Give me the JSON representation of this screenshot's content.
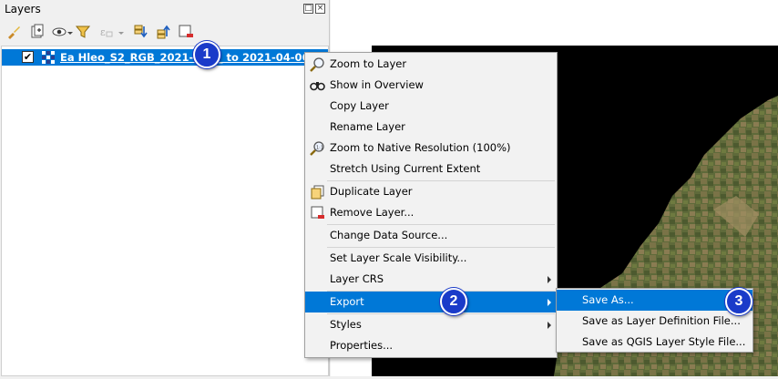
{
  "panel": {
    "title": "Layers",
    "float_btn": "□",
    "close_btn": "×"
  },
  "toolbar": {
    "icons": [
      "paintbrush-icon",
      "add-group-icon",
      "eye-icon",
      "filter-icon",
      "filter-expression-icon",
      "expand-all-icon",
      "collapse-all-icon",
      "remove-layer-icon"
    ]
  },
  "layer": {
    "checked": "✔",
    "name": "Ea Hleo_S2_RGB_2021-03-__ to 2021-04-06"
  },
  "context_menu": {
    "items": [
      {
        "label": "Zoom to Layer"
      },
      {
        "label": "Show in Overview"
      },
      {
        "label": "Copy Layer"
      },
      {
        "label": "Rename Layer"
      },
      {
        "label": "Zoom to Native Resolution (100%)"
      },
      {
        "label": "Stretch Using Current Extent"
      },
      {
        "label": "Duplicate Layer"
      },
      {
        "label": "Remove Layer..."
      },
      {
        "label": "Change Data Source..."
      },
      {
        "label": "Set Layer Scale Visibility..."
      },
      {
        "label": "Layer CRS"
      },
      {
        "label": "Export"
      },
      {
        "label": "Styles"
      },
      {
        "label": "Properties..."
      }
    ]
  },
  "export_submenu": {
    "items": [
      {
        "label": "Save As..."
      },
      {
        "label": "Save as Layer Definition File..."
      },
      {
        "label": "Save as QGIS Layer Style File..."
      }
    ]
  },
  "badges": [
    "1",
    "2",
    "3"
  ],
  "colors": {
    "highlight": "#0078d7",
    "badge": "#1a3bc9",
    "map_nodata": "#000000"
  }
}
